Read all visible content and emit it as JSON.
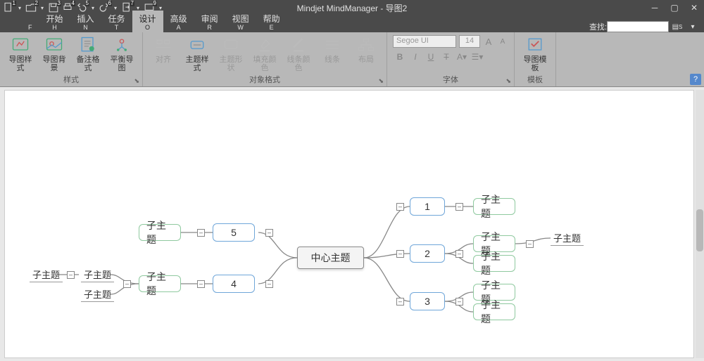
{
  "app": {
    "title": "Mindjet MindManager - 导图2"
  },
  "qat": [
    {
      "badge": "1"
    },
    {
      "badge": "2"
    },
    {
      "badge": "3"
    },
    {
      "badge": "4"
    },
    {
      "badge": "5"
    },
    {
      "badge": "6"
    },
    {
      "badge": "7"
    },
    {
      "badge": "9"
    }
  ],
  "tabs": [
    {
      "label": "",
      "shortcut": "F"
    },
    {
      "label": "开始",
      "shortcut": "H"
    },
    {
      "label": "插入",
      "shortcut": "N"
    },
    {
      "label": "任务",
      "shortcut": "T"
    },
    {
      "label": "设计",
      "shortcut": "O"
    },
    {
      "label": "高级",
      "shortcut": "A"
    },
    {
      "label": "审阅",
      "shortcut": "R"
    },
    {
      "label": "视图",
      "shortcut": "W"
    },
    {
      "label": "帮助",
      "shortcut": "E"
    }
  ],
  "active_tab": 4,
  "search": {
    "label": "查找:",
    "placeholder": "",
    "shortcut": "S"
  },
  "ribbon": {
    "groups": [
      {
        "name": "样式",
        "buttons": [
          {
            "label": "导图样式",
            "disabled": false,
            "icon": "map-style"
          },
          {
            "label": "导图背景",
            "disabled": false,
            "icon": "map-bg"
          },
          {
            "label": "备注格式",
            "disabled": false,
            "icon": "notes-format"
          },
          {
            "label": "平衡导图",
            "disabled": false,
            "icon": "balance"
          }
        ]
      },
      {
        "name": "对象格式",
        "buttons": [
          {
            "label": "对齐",
            "disabled": true,
            "icon": "align"
          },
          {
            "label": "主题样式",
            "disabled": false,
            "icon": "topic-style"
          },
          {
            "label": "主题形状",
            "disabled": true,
            "icon": "topic-shape"
          },
          {
            "label": "填充颜色",
            "disabled": true,
            "icon": "fill"
          },
          {
            "label": "线条颜色",
            "disabled": true,
            "icon": "line-color"
          },
          {
            "label": "线条",
            "disabled": true,
            "icon": "line"
          },
          {
            "label": "布局",
            "disabled": true,
            "icon": "layout"
          }
        ]
      }
    ],
    "font": {
      "name": "字体",
      "family": "Segoe UI",
      "size": "14",
      "tools": {
        "bold": "B",
        "italic": "I",
        "underline": "U",
        "strike": "T",
        "color": "A",
        "highlight": "☰"
      }
    },
    "template": {
      "name": "模板",
      "label": "导图模板",
      "icon": "template"
    }
  },
  "mindmap": {
    "central": "中心主题",
    "right": [
      {
        "label": "1",
        "children": [
          "子主题"
        ]
      },
      {
        "label": "2",
        "children": [
          "子主题",
          "子主题"
        ],
        "extra_leaf": "子主题"
      },
      {
        "label": "3",
        "children": [
          "子主题",
          "子主题"
        ]
      }
    ],
    "left": [
      {
        "label": "5",
        "children": [
          "子主题"
        ]
      },
      {
        "label": "4",
        "children": [
          "子主题"
        ],
        "deep": [
          "子主题",
          "子主题",
          "子主题"
        ]
      }
    ]
  }
}
